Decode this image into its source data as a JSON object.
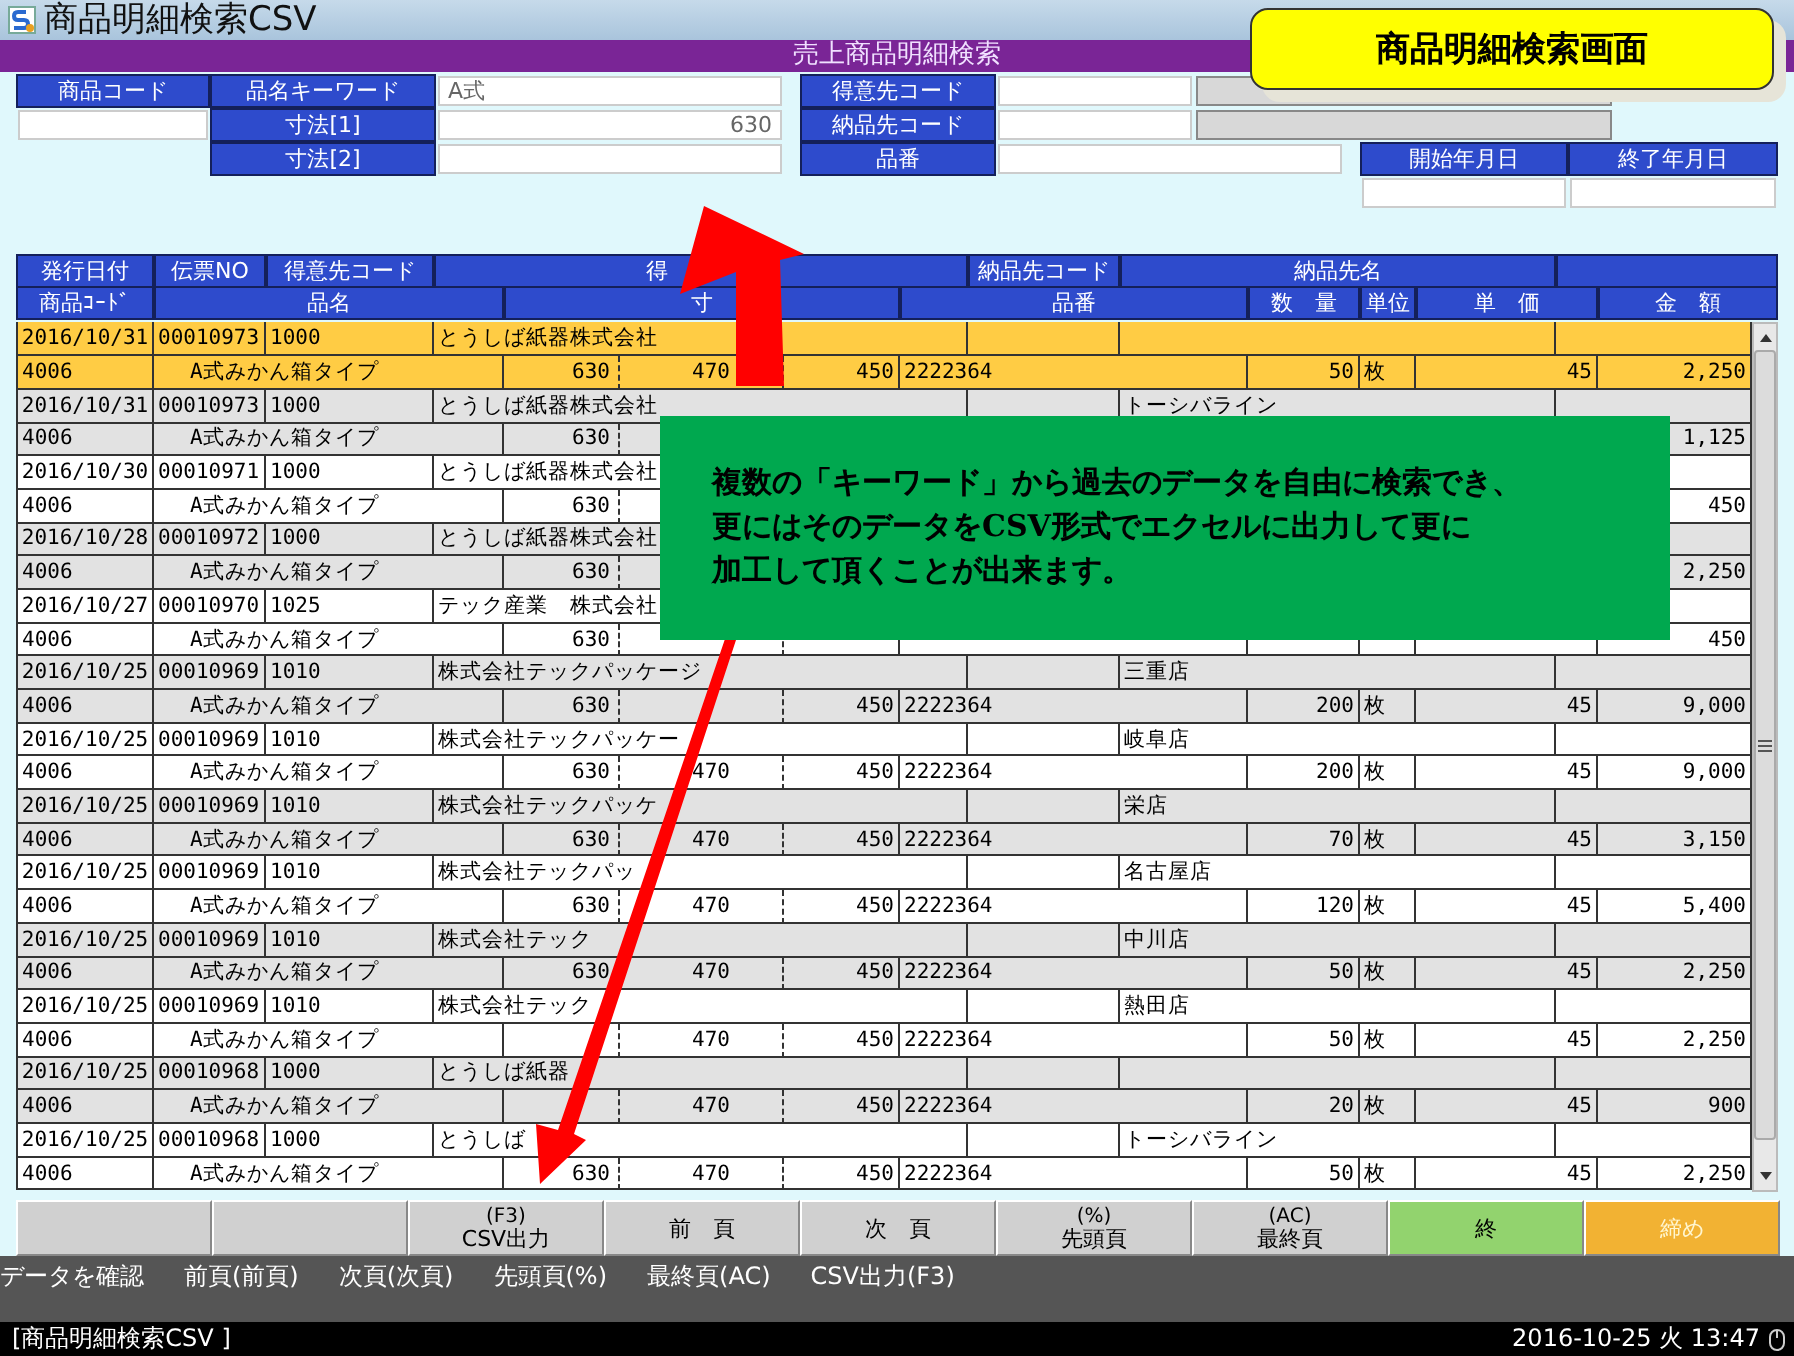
{
  "window": {
    "title": "商品明細検索CSV"
  },
  "screen_title": "売上商品明細検索",
  "callout": "商品明細検索画面",
  "note": [
    "複数の「キーワード」から過去のデータを自由に検索でき、",
    "更にはそのデータをCSV形式でエクセルに出力して更に",
    "加工して頂くことが出来ます。"
  ],
  "search_form": {
    "product_code": {
      "label": "商品コード"
    },
    "keyword": {
      "label": "品名キーワード",
      "value": "A式"
    },
    "size_1": {
      "label": "寸法[1]",
      "value": "630"
    },
    "size_2": {
      "label": "寸法[2]"
    },
    "customer_code": {
      "label": "得意先コード"
    },
    "delivery_code": {
      "label": "納品先コード"
    },
    "part_no": {
      "label": "品番"
    },
    "start_date": {
      "label": "開始年月日"
    },
    "end_date": {
      "label": "終了年月日"
    }
  },
  "table": {
    "header_1": [
      "発行日付",
      "伝票NO",
      "得意先コード",
      "得",
      "納品先コード",
      "納品先名"
    ],
    "header_2": [
      "商品ｺｰﾄﾞ",
      "品名",
      "寸",
      "品番",
      "数　量",
      "単位",
      "単　価",
      "金　額"
    ],
    "rows": [
      {
        "selected": true,
        "date": "2016/10/31",
        "slip_no": "00010973",
        "customer_code": "1000",
        "customer_name": "とうしば紙器株式会社",
        "product_code": "4006",
        "product_name": "A式みかん箱タイプ",
        "size_1": "630",
        "size_2": "470",
        "size_3": "450",
        "part_no": "2222364",
        "quantity": "50",
        "unit": "枚",
        "unit_price": "45",
        "amount": "2,250"
      },
      {
        "selected": false,
        "date": "2016/10/31",
        "slip_no": "00010973",
        "customer_code": "1000",
        "customer_name": "とうしば紙器株式会社",
        "delivery_name": "トーシバライン",
        "product_code": "4006",
        "product_name": "A式みかん箱タイプ",
        "size_1": "630",
        "amount": "1,125"
      },
      {
        "selected": false,
        "date": "2016/10/30",
        "slip_no": "00010971",
        "customer_code": "1000",
        "customer_name": "とうしば紙器株式会社",
        "product_code": "4006",
        "product_name": "A式みかん箱タイプ",
        "size_1": "630",
        "amount": "450"
      },
      {
        "selected": false,
        "date": "2016/10/28",
        "slip_no": "00010972",
        "customer_code": "1000",
        "customer_name": "とうしば紙器株式会社",
        "product_code": "4006",
        "product_name": "A式みかん箱タイプ",
        "size_1": "630",
        "amount": "2,250"
      },
      {
        "selected": false,
        "date": "2016/10/27",
        "slip_no": "00010970",
        "customer_code": "1025",
        "customer_name": "テック産業　株式会社",
        "product_code": "4006",
        "product_name": "A式みかん箱タイプ",
        "size_1": "630",
        "amount": "450"
      },
      {
        "selected": false,
        "date": "2016/10/25",
        "slip_no": "00010969",
        "customer_code": "1010",
        "customer_name": "株式会社テックパッケージ",
        "delivery_name": "三重店",
        "product_code": "4006",
        "product_name": "A式みかん箱タイプ",
        "size_1": "630",
        "size_3": "450",
        "part_no": "2222364",
        "quantity": "200",
        "unit": "枚",
        "unit_price": "45",
        "amount": "9,000"
      },
      {
        "selected": false,
        "date": "2016/10/25",
        "slip_no": "00010969",
        "customer_code": "1010",
        "customer_name": "株式会社テックパッケー",
        "delivery_name": "岐阜店",
        "product_code": "4006",
        "product_name": "A式みかん箱タイプ",
        "size_1": "630",
        "size_2": "470",
        "size_3": "450",
        "part_no": "2222364",
        "quantity": "200",
        "unit": "枚",
        "unit_price": "45",
        "amount": "9,000"
      },
      {
        "selected": false,
        "date": "2016/10/25",
        "slip_no": "00010969",
        "customer_code": "1010",
        "customer_name": "株式会社テックパッケ",
        "delivery_name": "栄店",
        "product_code": "4006",
        "product_name": "A式みかん箱タイプ",
        "size_1": "630",
        "size_2": "470",
        "size_3": "450",
        "part_no": "2222364",
        "quantity": "70",
        "unit": "枚",
        "unit_price": "45",
        "amount": "3,150"
      },
      {
        "selected": false,
        "date": "2016/10/25",
        "slip_no": "00010969",
        "customer_code": "1010",
        "customer_name": "株式会社テックパッ",
        "delivery_name": "名古屋店",
        "product_code": "4006",
        "product_name": "A式みかん箱タイプ",
        "size_1": "630",
        "size_2": "470",
        "size_3": "450",
        "part_no": "2222364",
        "quantity": "120",
        "unit": "枚",
        "unit_price": "45",
        "amount": "5,400"
      },
      {
        "selected": false,
        "date": "2016/10/25",
        "slip_no": "00010969",
        "customer_code": "1010",
        "customer_name": "株式会社テック",
        "delivery_name": "中川店",
        "product_code": "4006",
        "product_name": "A式みかん箱タイプ",
        "size_1": "630",
        "size_2": "470",
        "size_3": "450",
        "part_no": "2222364",
        "quantity": "50",
        "unit": "枚",
        "unit_price": "45",
        "amount": "2,250"
      },
      {
        "selected": false,
        "date": "2016/10/25",
        "slip_no": "00010969",
        "customer_code": "1010",
        "customer_name": "株式会社テック",
        "delivery_name": "熱田店",
        "product_code": "4006",
        "product_name": "A式みかん箱タイプ",
        "size_2": "470",
        "size_3": "450",
        "part_no": "2222364",
        "quantity": "50",
        "unit": "枚",
        "unit_price": "45",
        "amount": "2,250"
      },
      {
        "selected": false,
        "date": "2016/10/25",
        "slip_no": "00010968",
        "customer_code": "1000",
        "customer_name": "とうしば紙器",
        "product_code": "4006",
        "product_name": "A式みかん箱タイプ",
        "size_2": "470",
        "size_3": "450",
        "part_no": "2222364",
        "quantity": "20",
        "unit": "枚",
        "unit_price": "45",
        "amount": "900"
      },
      {
        "selected": false,
        "date": "2016/10/25",
        "slip_no": "00010968",
        "customer_code": "1000",
        "customer_name": "とうしば",
        "delivery_name": "トーシバライン",
        "product_code": "4006",
        "product_name": "A式みかん箱タイプ",
        "size_1": "630",
        "size_2": "470",
        "size_3": "450",
        "part_no": "2222364",
        "quantity": "50",
        "unit": "枚",
        "unit_price": "45",
        "amount": "2,250"
      }
    ]
  },
  "function_keys": [
    {
      "kind": "blank"
    },
    {
      "kind": "blank"
    },
    {
      "kind": "key",
      "key": "(F3)",
      "label": "CSV出力"
    },
    {
      "kind": "key",
      "label": "前　頁"
    },
    {
      "kind": "key",
      "label": "次　頁"
    },
    {
      "kind": "key",
      "key": "(%)",
      "label": "先頭頁"
    },
    {
      "kind": "key",
      "key": "(AC)",
      "label": "最終頁"
    },
    {
      "kind": "exit",
      "label": "終"
    },
    {
      "kind": "close",
      "label": "締め"
    }
  ],
  "hints": [
    "データを確認",
    "前頁(前頁)",
    "次頁(次頁)",
    "先頭頁(%)",
    "最終頁(AC)",
    "CSV出力(F3)"
  ],
  "status_bar": {
    "program": "[商品明細検索CSV ]",
    "datetime": "2016-10-25 火 13:47"
  }
}
